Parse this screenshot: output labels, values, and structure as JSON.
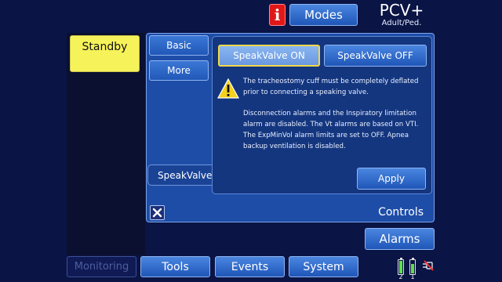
{
  "header": {
    "info_glyph": "i",
    "modes_label": "Modes",
    "mode_title": "PCV+",
    "mode_subtitle": "Adult/Ped."
  },
  "left": {
    "standby_label": "Standby"
  },
  "controls": {
    "tabs": [
      {
        "label": "Basic"
      },
      {
        "label": "More"
      },
      {
        "label": "SpeakValve"
      }
    ],
    "speakvalve_on_label": "SpeakValve ON",
    "speakvalve_off_label": "SpeakValve OFF",
    "warning_paragraph_1": "The tracheostomy cuff must be completely deflated prior to connecting a speaking valve.",
    "warning_paragraph_2": "Disconnection alarms and the Inspiratory limitation alarm are disabled. The Vt alarms are based on VTI. The ExpMinVol alarm limits are set to OFF. Apnea backup ventilation is disabled.",
    "apply_label": "Apply",
    "window_title": "Controls",
    "selected_option": "SpeakValve ON"
  },
  "bottom": {
    "alarms_label": "Alarms",
    "monitoring_label": "Monitoring",
    "tools_label": "Tools",
    "events_label": "Events",
    "system_label": "System",
    "battery_2_label": "2",
    "battery_1_label": "1"
  },
  "icons": {
    "info": "info-icon",
    "warning": "warning-triangle-icon",
    "close": "close-icon",
    "battery": "battery-icon",
    "no_ac": "ac-power-disconnected-icon"
  },
  "colors": {
    "background": "#0a1445",
    "accent_blue": "#2a63c8",
    "standby_yellow": "#f6f25a",
    "warning_yellow": "#f4d21c",
    "info_red": "#e01818",
    "selected_outline": "#f0d84a"
  }
}
